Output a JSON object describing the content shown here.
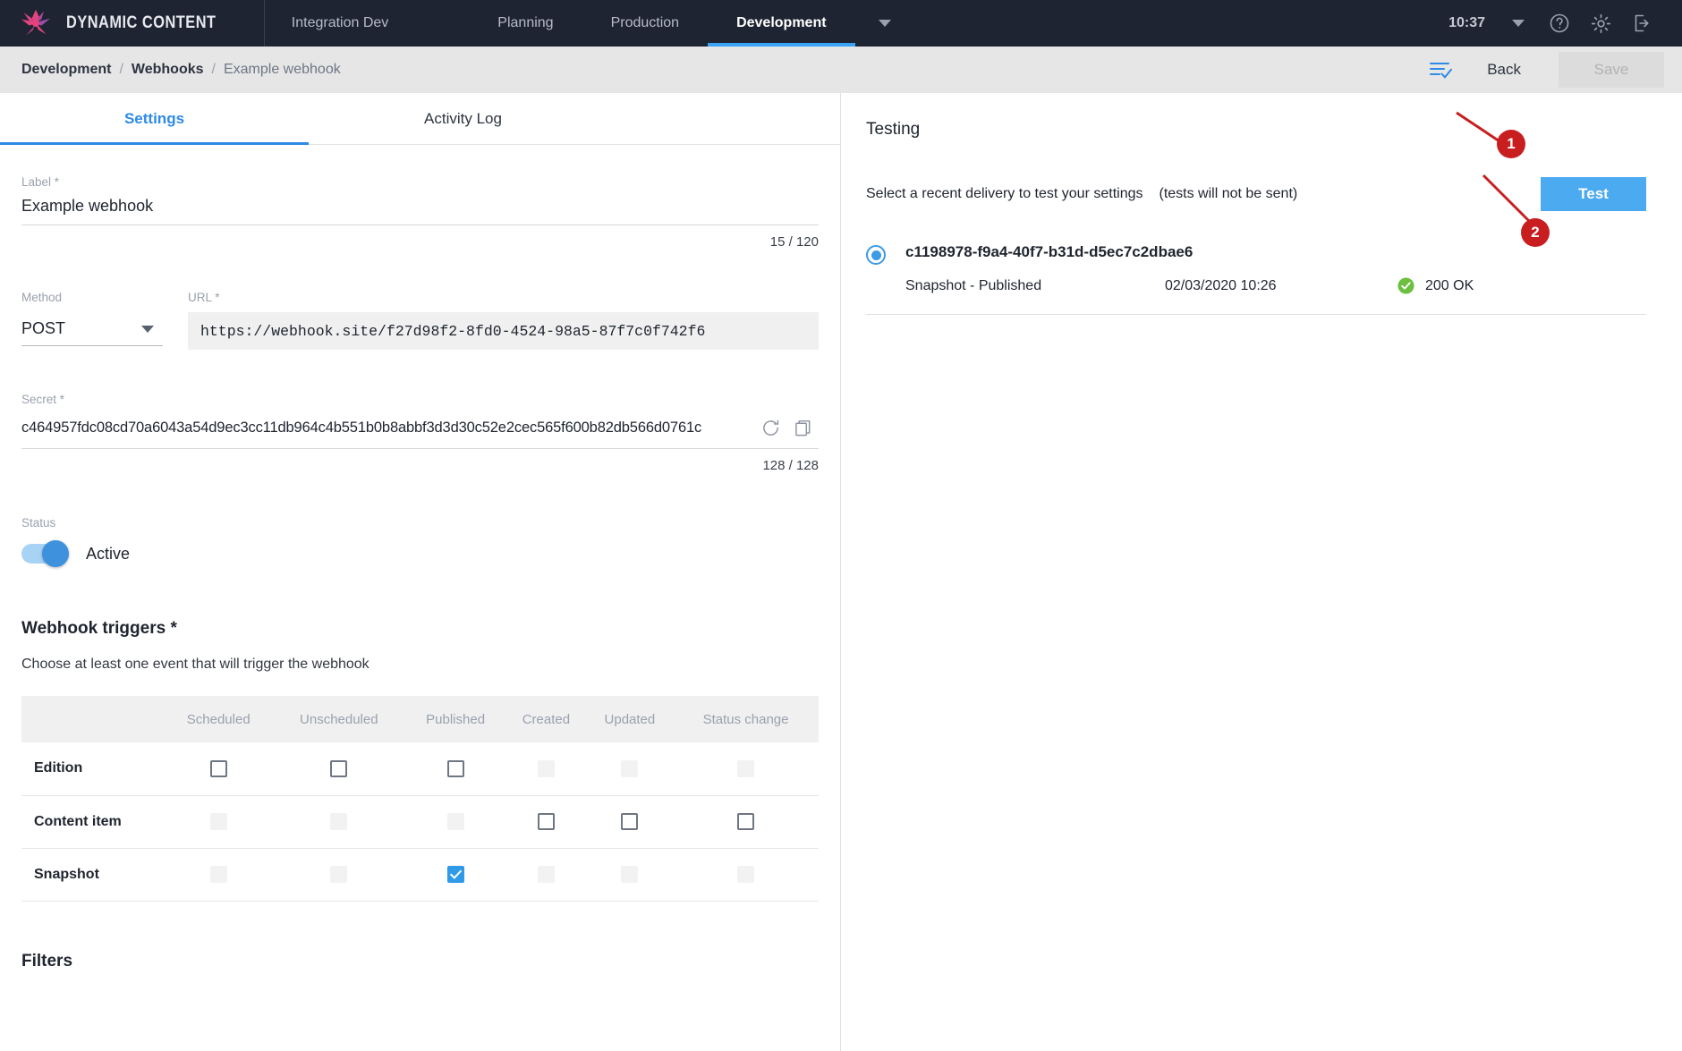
{
  "topnav": {
    "brand": "DYNAMIC CONTENT",
    "hub": "Integration Dev",
    "tabs": [
      {
        "label": "Planning",
        "active": false
      },
      {
        "label": "Production",
        "active": false
      },
      {
        "label": "Development",
        "active": true
      }
    ],
    "clock": "10:37",
    "icons": [
      "caret-down-icon",
      "help-icon",
      "gear-icon",
      "logout-icon"
    ]
  },
  "breadcrumb": {
    "items": [
      "Development",
      "Webhooks",
      "Example webhook"
    ],
    "separator": "/",
    "back_label": "Back",
    "save_label": "Save"
  },
  "tabs": [
    {
      "label": "Settings",
      "active": true
    },
    {
      "label": "Activity Log",
      "active": false
    }
  ],
  "form": {
    "label_field": {
      "label": "Label *",
      "value": "Example webhook",
      "counter": "15 / 120"
    },
    "method_field": {
      "label": "Method",
      "value": "POST"
    },
    "url_field": {
      "label": "URL *",
      "value": "https://webhook.site/f27d98f2-8fd0-4524-98a5-87f7c0f742f6"
    },
    "secret_field": {
      "label": "Secret *",
      "value": "c464957fdc08cd70a6043a54d9ec3cc11db964c4b551b0b8abbf3d3d30c52e2cec565f600b82db566d0761c",
      "counter": "128 / 128",
      "refresh_icon": "refresh-icon",
      "copy_icon": "copy-icon"
    },
    "status_field": {
      "label": "Status",
      "toggle_state": "on",
      "toggle_label": "Active"
    },
    "triggers": {
      "title": "Webhook triggers *",
      "help": "Choose at least one event that will trigger the webhook",
      "columns": [
        "",
        "Scheduled",
        "Unscheduled",
        "Published",
        "Created",
        "Updated",
        "Status change"
      ],
      "rows": [
        {
          "name": "Edition",
          "cells": [
            "enabled",
            "enabled",
            "enabled",
            "disabled",
            "disabled",
            "disabled"
          ]
        },
        {
          "name": "Content item",
          "cells": [
            "disabled",
            "disabled",
            "disabled",
            "enabled",
            "enabled",
            "enabled"
          ]
        },
        {
          "name": "Snapshot",
          "cells": [
            "disabled",
            "disabled",
            "checked",
            "disabled",
            "disabled",
            "disabled"
          ]
        }
      ]
    },
    "filters": {
      "title": "Filters",
      "help": ""
    }
  },
  "testing": {
    "title": "Testing",
    "description": "Select a recent delivery to test your settings",
    "note": "(tests will not be sent)",
    "test_button": "Test",
    "deliveries": [
      {
        "id": "c1198978-f9a4-40f7-b31d-d5ec7c2dbae6",
        "type": "Snapshot - Published",
        "date": "02/03/2020 10:26",
        "status_code": "200 OK",
        "status_icon": "check-circle-icon",
        "selected": true
      }
    ]
  },
  "callouts": [
    {
      "number": "1"
    },
    {
      "number": "2"
    }
  ],
  "colors": {
    "accent": "#2e8ae6",
    "nav_bg": "#1e2432",
    "callout": "#c81e20",
    "success": "#6cbf3f",
    "test_button": "#4caaf0"
  }
}
